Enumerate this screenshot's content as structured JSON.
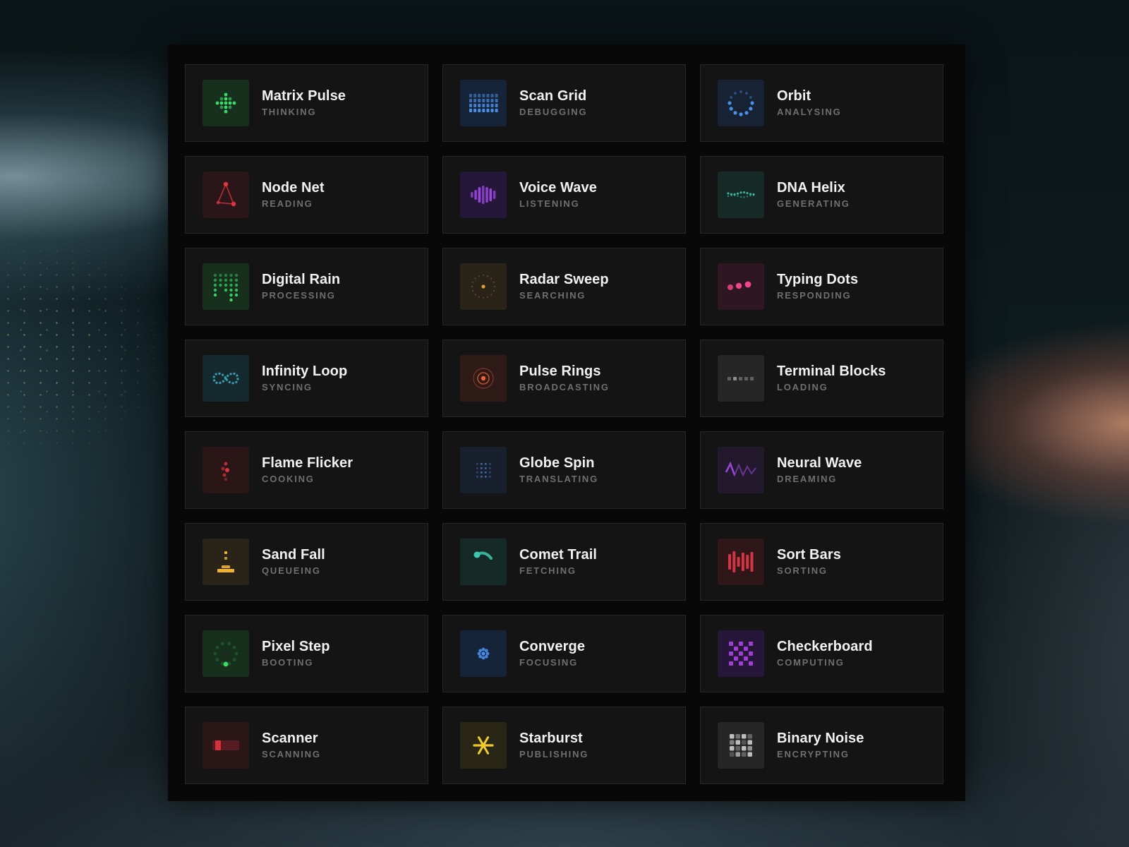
{
  "cards": [
    {
      "title": "Matrix Pulse",
      "status": "THINKING",
      "icon": "matrix-pulse-icon",
      "color": "#3ddc6a",
      "bg": "#16301d"
    },
    {
      "title": "Scan Grid",
      "status": "DEBUGGING",
      "icon": "scan-grid-icon",
      "color": "#4a8fe8",
      "bg": "#16243a"
    },
    {
      "title": "Orbit",
      "status": "ANALYSING",
      "icon": "orbit-icon",
      "color": "#4a8fe8",
      "bg": "#172235"
    },
    {
      "title": "Node Net",
      "status": "READING",
      "icon": "node-net-icon",
      "color": "#e0353f",
      "bg": "#2a1518"
    },
    {
      "title": "Voice Wave",
      "status": "LISTENING",
      "icon": "voice-wave-icon",
      "color": "#a64df0",
      "bg": "#24173a"
    },
    {
      "title": "DNA Helix",
      "status": "GENERATING",
      "icon": "dna-helix-icon",
      "color": "#3fc8b0",
      "bg": "#152a26"
    },
    {
      "title": "Digital Rain",
      "status": "PROCESSING",
      "icon": "digital-rain-icon",
      "color": "#3ddc6a",
      "bg": "#16301d"
    },
    {
      "title": "Radar Sweep",
      "status": "SEARCHING",
      "icon": "radar-sweep-icon",
      "color": "#e0a030",
      "bg": "#2a2418"
    },
    {
      "title": "Typing Dots",
      "status": "RESPONDING",
      "icon": "typing-dots-icon",
      "color": "#f0458a",
      "bg": "#2e1722"
    },
    {
      "title": "Infinity Loop",
      "status": "SYNCING",
      "icon": "infinity-loop-icon",
      "color": "#3fb0c8",
      "bg": "#152a2e"
    },
    {
      "title": "Pulse Rings",
      "status": "BROADCASTING",
      "icon": "pulse-rings-icon",
      "color": "#f0603a",
      "bg": "#2e1a16"
    },
    {
      "title": "Terminal Blocks",
      "status": "LOADING",
      "icon": "terminal-blocks-icon",
      "color": "#9a9a9a",
      "bg": "#262626"
    },
    {
      "title": "Flame Flicker",
      "status": "COOKING",
      "icon": "flame-flicker-icon",
      "color": "#e0353f",
      "bg": "#2a1517"
    },
    {
      "title": "Globe Spin",
      "status": "TRANSLATING",
      "icon": "globe-spin-icon",
      "color": "#4a7ac8",
      "bg": "#18202e"
    },
    {
      "title": "Neural Wave",
      "status": "DREAMING",
      "icon": "neural-wave-icon",
      "color": "#9a45d8",
      "bg": "#221a2c"
    },
    {
      "title": "Sand Fall",
      "status": "QUEUEING",
      "icon": "sand-fall-icon",
      "color": "#f0b030",
      "bg": "#2a2418"
    },
    {
      "title": "Comet Trail",
      "status": "FETCHING",
      "icon": "comet-trail-icon",
      "color": "#3fc8b0",
      "bg": "#152a26"
    },
    {
      "title": "Sort Bars",
      "status": "SORTING",
      "icon": "sort-bars-icon",
      "color": "#f03a4a",
      "bg": "#2e1619"
    },
    {
      "title": "Pixel Step",
      "status": "BOOTING",
      "icon": "pixel-step-icon",
      "color": "#3ddc6a",
      "bg": "#16301d"
    },
    {
      "title": "Converge",
      "status": "FOCUSING",
      "icon": "converge-icon",
      "color": "#4a8fe8",
      "bg": "#16243a"
    },
    {
      "title": "Checkerboard",
      "status": "COMPUTING",
      "icon": "checkerboard-icon",
      "color": "#b040e8",
      "bg": "#26163a"
    },
    {
      "title": "Scanner",
      "status": "SCANNING",
      "icon": "scanner-icon",
      "color": "#e0353f",
      "bg": "#2a1517"
    },
    {
      "title": "Starburst",
      "status": "PUBLISHING",
      "icon": "starburst-icon",
      "color": "#f0c830",
      "bg": "#2a2616"
    },
    {
      "title": "Binary Noise",
      "status": "ENCRYPTING",
      "icon": "binary-noise-icon",
      "color": "#bdbdbd",
      "bg": "#262626"
    }
  ]
}
